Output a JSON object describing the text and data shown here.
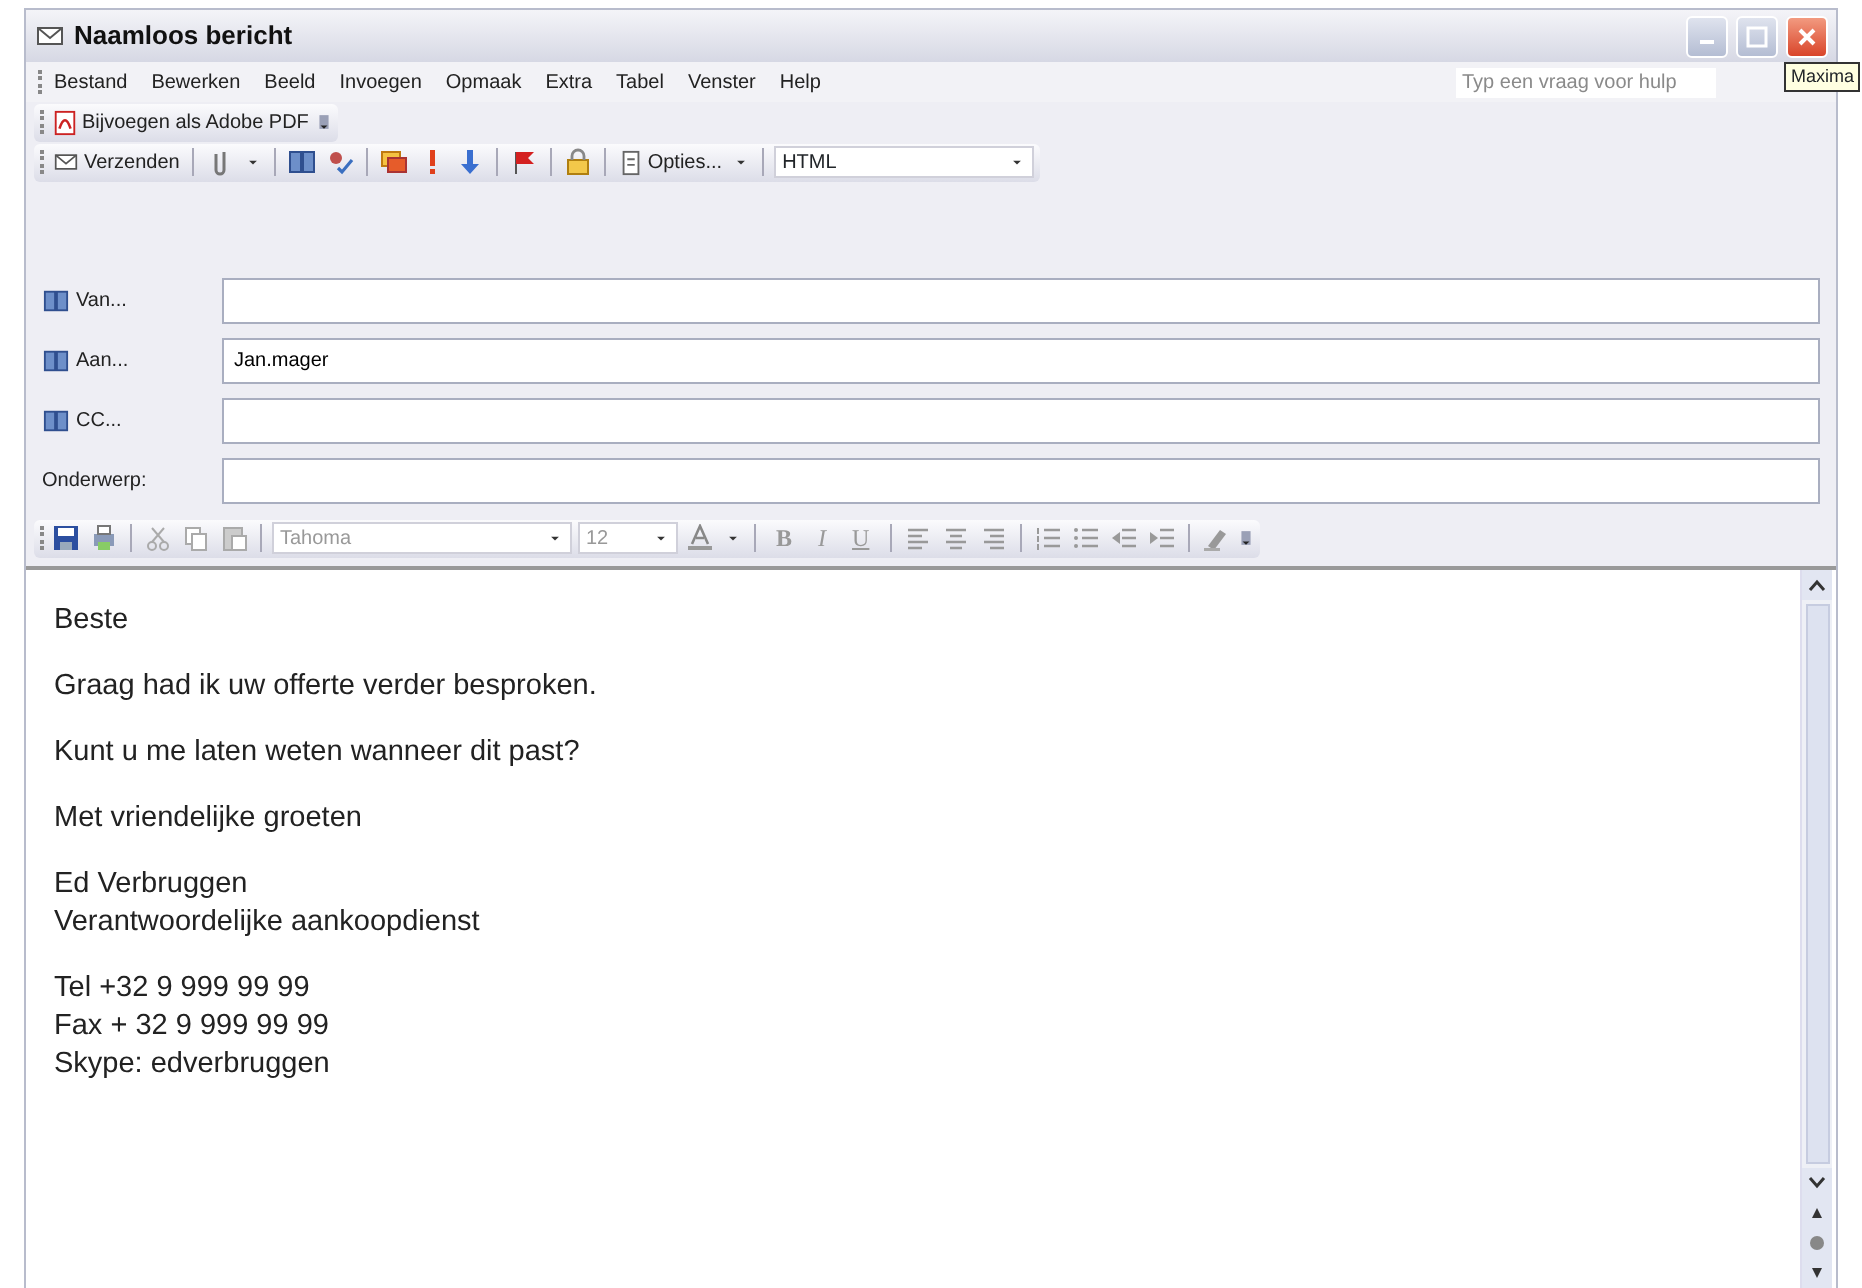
{
  "window": {
    "title": "Naamloos bericht",
    "tooltip": "Maxima"
  },
  "menu": [
    "Bestand",
    "Bewerken",
    "Beeld",
    "Invoegen",
    "Opmaak",
    "Extra",
    "Tabel",
    "Venster",
    "Help"
  ],
  "help_search": {
    "placeholder": "Typ een vraag voor hulp"
  },
  "pdf_toolbar": {
    "button": "Bijvoegen als Adobe PDF"
  },
  "standard_toolbar": {
    "send": "Verzenden",
    "options": "Opties...",
    "format": "HTML"
  },
  "fields": [
    {
      "label": "Van...",
      "kind": "address"
    },
    {
      "label": "Aan...",
      "kind": "address",
      "value": "Jan.mager"
    },
    {
      "label": "CC...",
      "kind": "address"
    },
    {
      "label": "Onderwerp:",
      "kind": "plain"
    }
  ],
  "format_toolbar": {
    "disabled": true,
    "font": "Tahoma",
    "size": "12",
    "bold": "B",
    "italic": "I",
    "underline": "U"
  },
  "body": [
    [
      "Beste"
    ],
    [
      "Graag had ik uw offerte verder besproken."
    ],
    [
      "Kunt u me laten weten wanneer dit past?"
    ],
    [
      "Met vriendelijke groeten"
    ],
    [
      "Ed Verbruggen",
      "Verantwoordelijke aankoopdienst"
    ],
    [
      "Tel +32 9 999 99 99",
      "Fax + 32 9 999 99 99",
      "Skype: edverbruggen"
    ]
  ]
}
